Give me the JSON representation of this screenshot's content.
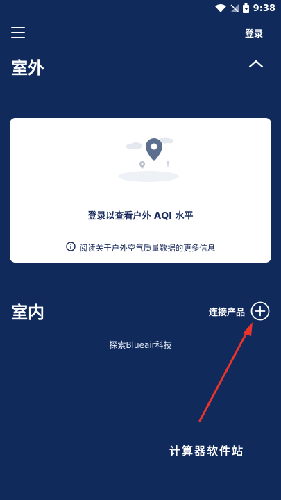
{
  "status_bar": {
    "time": "9:38"
  },
  "app_bar": {
    "login_label": "登录"
  },
  "outdoor": {
    "title": "室外",
    "card": {
      "prompt": "登录以查看户外 AQI 水平",
      "info_text": "阅读关于户外空气质量数据的更多信息"
    }
  },
  "indoor": {
    "title": "室内",
    "connect_label": "连接产品",
    "explore_label": "探索Blueair科技"
  },
  "watermark": {
    "text": "计算器软件站"
  },
  "colors": {
    "background": "#102a5c",
    "card": "#ffffff",
    "card_text": "#17295a",
    "annotation_arrow": "#e8342c"
  }
}
